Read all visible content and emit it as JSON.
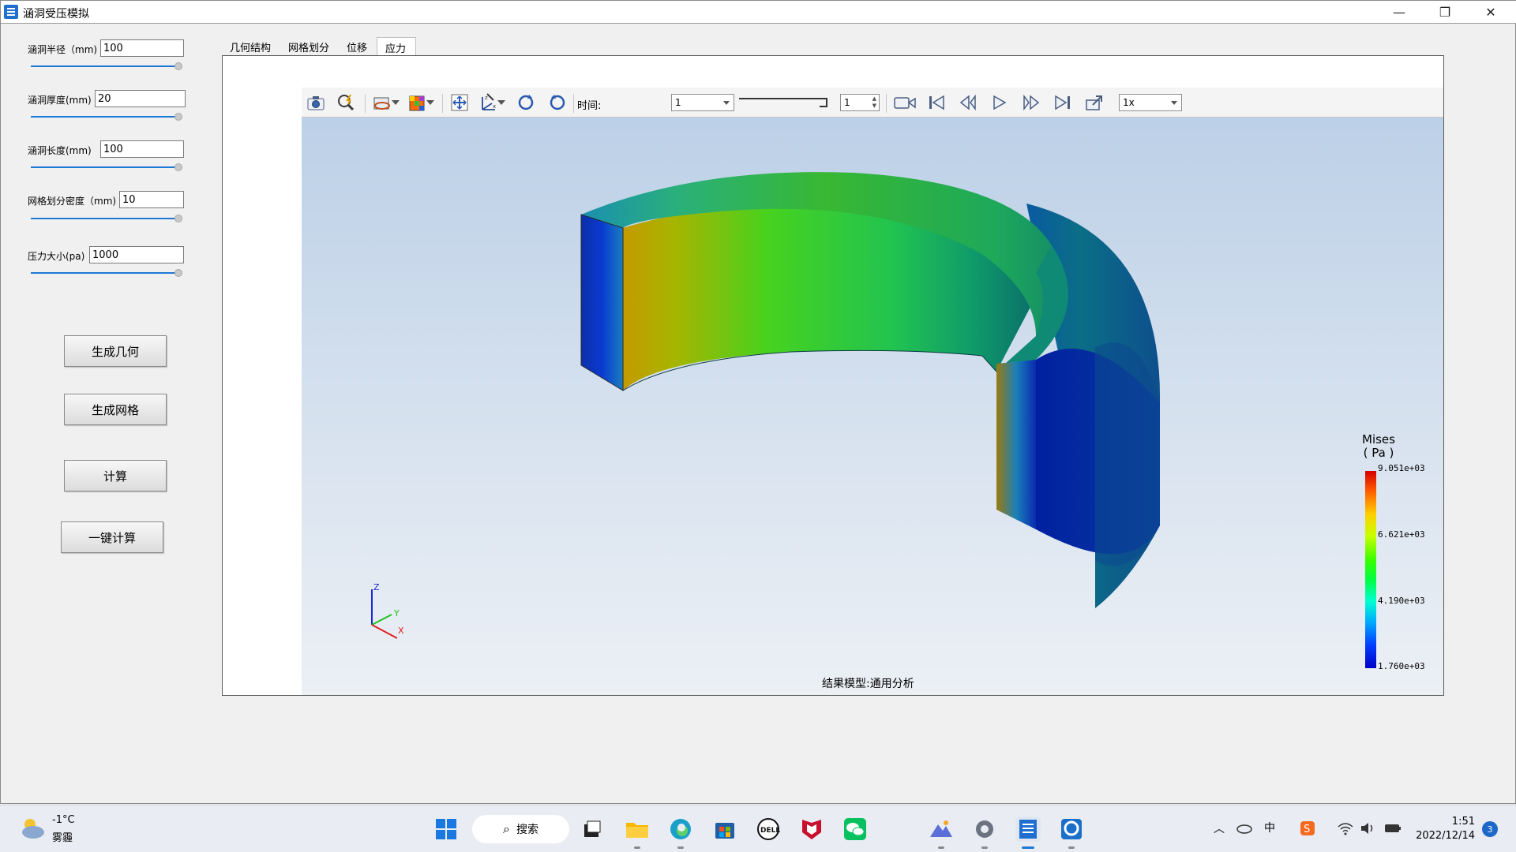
{
  "app": {
    "title": "涵洞受压模拟"
  },
  "window_controls": {
    "minimize": "—",
    "restore": "❐",
    "close": "✕"
  },
  "params": [
    {
      "label": "涵洞半径（mm)",
      "value": "100"
    },
    {
      "label": "涵洞厚度(mm)",
      "value": "20"
    },
    {
      "label": "涵洞长度(mm)",
      "value": "100"
    },
    {
      "label": "网格划分密度（mm)",
      "value": "10"
    },
    {
      "label": "压力大小(pa)",
      "value": "1000"
    }
  ],
  "buttons": {
    "gen_geometry": "生成几何",
    "gen_mesh": "生成网格",
    "compute": "计算",
    "one_click": "一键计算"
  },
  "tabs": [
    "几何结构",
    "网格划分",
    "位移",
    "应力"
  ],
  "active_tab": "应力",
  "toolbar": {
    "time_label": "时间:",
    "time_value": "1",
    "step_value": "1",
    "speed_value": "1x"
  },
  "axes_triad": {
    "z": "Z",
    "y": "Y",
    "x": "X"
  },
  "legend": {
    "title_line1": "Mises",
    "title_line2": "( Pa )",
    "ticks": [
      "9.051e+03",
      "6.621e+03",
      "4.190e+03",
      "1.760e+03"
    ]
  },
  "result_model": "结果模型:通用分析",
  "taskbar": {
    "weather_temp": "-1°C",
    "weather_desc": "雾霾",
    "search_label": "搜索",
    "time": "1:51",
    "date": "2022/12/14",
    "notifications": "3"
  },
  "colors": {
    "accent": "#1e78d4",
    "taskbar": "#e9edf3"
  }
}
